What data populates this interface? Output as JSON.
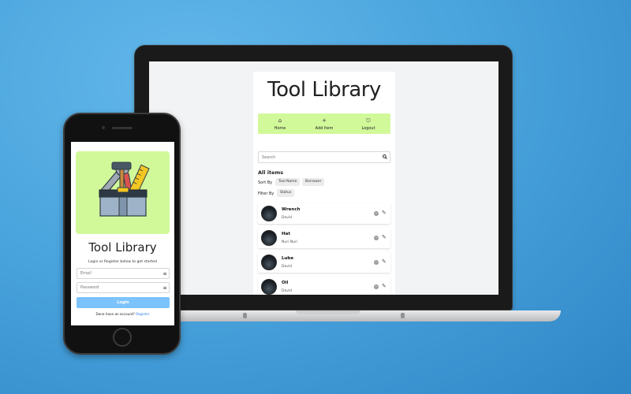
{
  "desktop": {
    "app_title": "Tool Library",
    "nav": [
      {
        "icon": "home-icon",
        "glyph": "⌂",
        "label": "Home"
      },
      {
        "icon": "plus-icon",
        "glyph": "+",
        "label": "Add Item"
      },
      {
        "icon": "logout-icon",
        "glyph": "⎋",
        "label": "Logout"
      }
    ],
    "search": {
      "placeholder": "Search"
    },
    "section_title": "All items",
    "sort": {
      "label": "Sort By",
      "options": [
        "Tool Name",
        "Borrower"
      ]
    },
    "filter": {
      "label": "Filter By",
      "options": [
        "Status"
      ]
    },
    "items": [
      {
        "name": "Wrench",
        "borrower": "David"
      },
      {
        "name": "Hat",
        "borrower": "Nuri Nuri"
      },
      {
        "name": "Lube",
        "borrower": "David"
      },
      {
        "name": "Oil",
        "borrower": "David"
      }
    ]
  },
  "mobile": {
    "app_title": "Tool Library",
    "subtitle": "Login or Register below to get started",
    "email": {
      "placeholder": "Email"
    },
    "password": {
      "placeholder": "Password"
    },
    "login_label": "Login",
    "register_prompt": "Done have an account?",
    "register_link": "Register"
  },
  "colors": {
    "accent_green": "#d1f99a",
    "login_blue": "#7cc3fb",
    "link_blue": "#2f80ed"
  }
}
